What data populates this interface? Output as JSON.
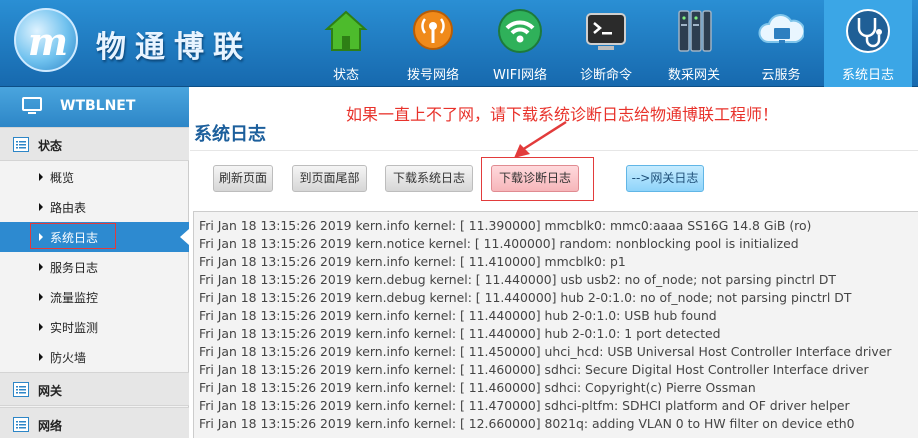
{
  "header": {
    "brand": "物通博联",
    "nav": [
      {
        "label": "状态",
        "icon": "house-icon"
      },
      {
        "label": "拨号网络",
        "icon": "antenna-icon"
      },
      {
        "label": "WIFI网络",
        "icon": "wifi-icon"
      },
      {
        "label": "诊断命令",
        "icon": "terminal-icon"
      },
      {
        "label": "数采网关",
        "icon": "server-icon"
      },
      {
        "label": "云服务",
        "icon": "cloud-icon"
      },
      {
        "label": "系统日志",
        "icon": "stethoscope-icon"
      }
    ],
    "active_nav": "系统日志"
  },
  "sidebar": {
    "title": "WTBLNET",
    "sections": [
      {
        "label": "状态",
        "items": [
          "概览",
          "路由表",
          "系统日志",
          "服务日志",
          "流量监控",
          "实时监测",
          "防火墙"
        ]
      },
      {
        "label": "网关"
      },
      {
        "label": "网络"
      }
    ],
    "active_item": "系统日志"
  },
  "main": {
    "notice": "如果一直上不了网，请下载系统诊断日志给物通博联工程师！",
    "title": "系统日志",
    "buttons": [
      "刷新页面",
      "到页面尾部",
      "下载系统日志",
      "下载诊断日志",
      "-->网关日志"
    ],
    "log_lines": [
      "Fri Jan 18 13:15:26 2019 kern.info kernel: [   11.390000] mmcblk0: mmc0:aaaa SS16G 14.8 GiB (ro)",
      "Fri Jan 18 13:15:26 2019 kern.notice kernel: [   11.400000] random: nonblocking pool is initialized",
      "Fri Jan 18 13:15:26 2019 kern.info kernel: [   11.410000]  mmcblk0: p1",
      "Fri Jan 18 13:15:26 2019 kern.debug kernel: [   11.440000] usb usb2: no of_node; not parsing pinctrl DT",
      "Fri Jan 18 13:15:26 2019 kern.debug kernel: [   11.440000] hub 2-0:1.0: no of_node; not parsing pinctrl DT",
      "Fri Jan 18 13:15:26 2019 kern.info kernel: [   11.440000] hub 2-0:1.0: USB hub found",
      "Fri Jan 18 13:15:26 2019 kern.info kernel: [   11.440000] hub 2-0:1.0: 1 port detected",
      "Fri Jan 18 13:15:26 2019 kern.info kernel: [   11.450000] uhci_hcd: USB Universal Host Controller Interface driver",
      "Fri Jan 18 13:15:26 2019 kern.info kernel: [   11.460000] sdhci: Secure Digital Host Controller Interface driver",
      "Fri Jan 18 13:15:26 2019 kern.info kernel: [   11.460000] sdhci: Copyright(c) Pierre Ossman",
      "Fri Jan 18 13:15:26 2019 kern.info kernel: [   11.470000] sdhci-pltfm: SDHCI platform and OF driver helper",
      "Fri Jan 18 13:15:26 2019 kern.info kernel: [   12.660000] 8021q: adding VLAN 0 to HW filter on device eth0"
    ]
  },
  "colors": {
    "header_blue": "#1d77bd",
    "active_tab": "#3ba6e6",
    "title_blue": "#1c5f9c",
    "notice_red": "#e8322b",
    "highlight_red": "#e23b3b"
  }
}
